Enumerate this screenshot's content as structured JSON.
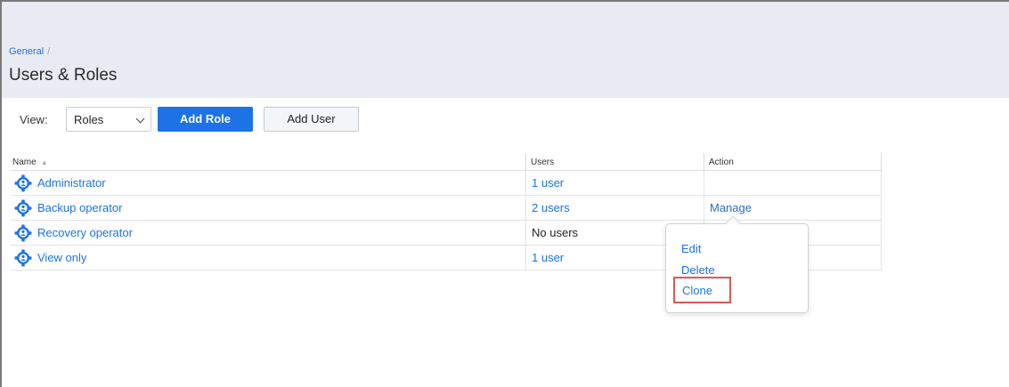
{
  "header": {
    "breadcrumb_root": "General",
    "breadcrumb_sep": "/",
    "title": "Users & Roles"
  },
  "toolbar": {
    "view_label": "View:",
    "view_selected": "Roles",
    "add_role_label": "Add Role",
    "add_user_label": "Add User"
  },
  "table": {
    "columns": {
      "name": "Name",
      "users": "Users",
      "action": "Action"
    },
    "rows": [
      {
        "name": "Administrator",
        "users": "1 user",
        "action": ""
      },
      {
        "name": "Backup operator",
        "users": "2 users",
        "action": "Manage"
      },
      {
        "name": "Recovery operator",
        "users": "No users",
        "action": ""
      },
      {
        "name": "View only",
        "users": "1 user",
        "action": ""
      }
    ]
  },
  "menu": {
    "edit": "Edit",
    "delete": "Delete",
    "clone": "Clone"
  },
  "icons": {
    "role": "role-gear-user-icon",
    "sort": "sort-asc-icon",
    "dropdown": "chevron-down-icon"
  },
  "colors": {
    "accent": "#1d73e6",
    "header_bg": "#e8ebf2",
    "highlight": "#e05757"
  }
}
